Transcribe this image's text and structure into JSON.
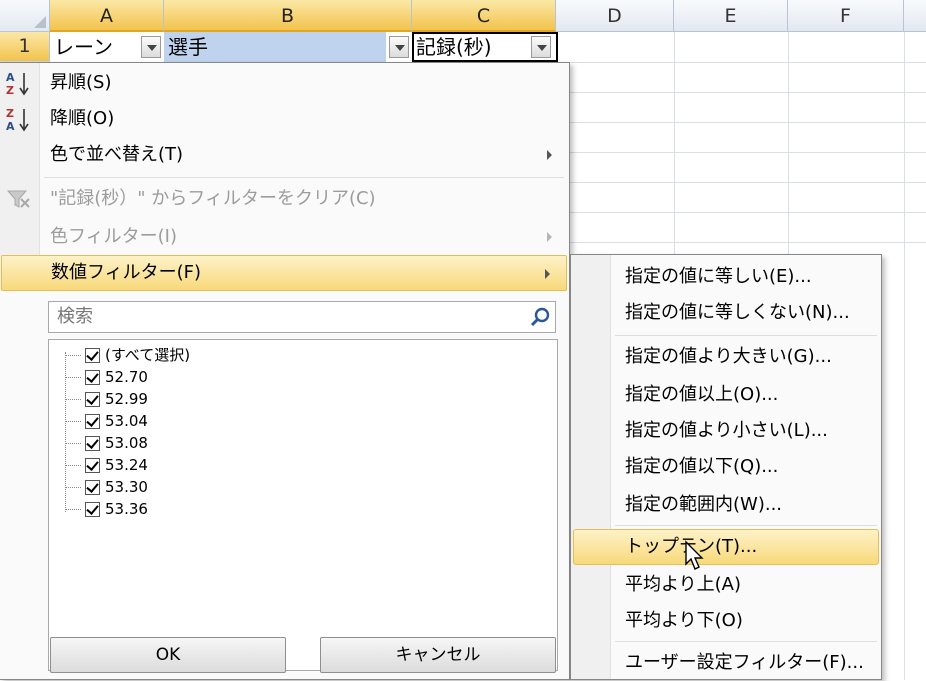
{
  "sheet": {
    "columns": [
      "A",
      "B",
      "C",
      "D",
      "E",
      "F"
    ],
    "row_number": "1",
    "cells": {
      "a1": "レーン",
      "b1": "選手",
      "c1": "記録(秒)"
    }
  },
  "filter_menu": {
    "items": [
      {
        "label": "昇順(S)",
        "icon": "sort-ascending-icon"
      },
      {
        "label": "降順(O)",
        "icon": "sort-descending-icon"
      },
      {
        "label": "色で並べ替え(T)"
      },
      {
        "label": "\"記録(秒）\" からフィルターをクリア(C)",
        "icon": "clear-filter-icon"
      },
      {
        "label": "色フィルター(I)"
      },
      {
        "label": "数値フィルター(F)"
      }
    ],
    "search_placeholder": "検索",
    "values": [
      "(すべて選択)",
      "52.70",
      "52.99",
      "53.04",
      "53.08",
      "53.24",
      "53.30",
      "53.36"
    ],
    "ok_label": "OK",
    "cancel_label": "キャンセル"
  },
  "number_filter_submenu": {
    "items": [
      "指定の値に等しい(E)...",
      "指定の値に等しくない(N)...",
      "指定の値より大きい(G)...",
      "指定の値以上(O)...",
      "指定の値より小さい(L)...",
      "指定の値以下(Q)...",
      "指定の範囲内(W)...",
      "トップテン(T)...",
      "平均より上(A)",
      "平均より下(O)",
      "ユーザー設定フィルター(F)..."
    ]
  },
  "colors": {
    "hover": "#f8d97a",
    "selected_header": "#f2c34e",
    "cell_highlight": "#bfd3ee"
  }
}
